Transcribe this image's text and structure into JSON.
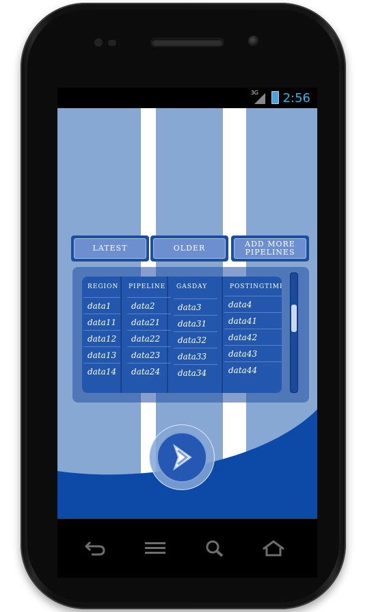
{
  "status_bar": {
    "network": "3G",
    "time": "2:56",
    "icons": [
      "signal-icon",
      "battery-icon"
    ]
  },
  "buttons": {
    "latest": "LATEST",
    "older": "OLDER",
    "add_more_line1": "ADD MORE",
    "add_more_line2": "PIPELINES"
  },
  "table": {
    "headers": [
      "REGION",
      "PIPELINE",
      "GASDAY",
      "POSTINGTIME"
    ],
    "rows": [
      [
        "data1",
        "data2",
        "data3",
        "data4"
      ],
      [
        "data11",
        "data21",
        "data31",
        "data41"
      ],
      [
        "data12",
        "data22",
        "data32",
        "data42"
      ],
      [
        "data13",
        "data23",
        "data33",
        "data43"
      ],
      [
        "data14",
        "data24",
        "data34",
        "data44"
      ]
    ]
  },
  "next_button": {
    "icon": "chevron-right-icon"
  },
  "nav_bar": {
    "icons": [
      "back-icon",
      "menu-icon",
      "search-icon",
      "home-icon"
    ]
  },
  "colors": {
    "background": "#87a8d3",
    "primary": "#2356ad",
    "dark_blue": "#0d4aa8",
    "button_face": "#6d8fcf",
    "clock": "#33b5e5"
  }
}
